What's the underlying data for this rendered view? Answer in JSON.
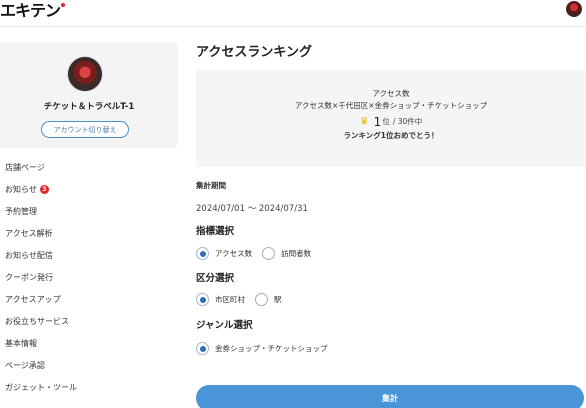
{
  "header": {
    "logo_text": "エキテン"
  },
  "sidebar": {
    "profile_name": "チケット＆トラベルT-1",
    "switch_account_label": "アカウント切り替え",
    "menu": [
      {
        "label": "店舗ページ"
      },
      {
        "label": "お知らせ",
        "badge": "3"
      },
      {
        "label": "予約管理"
      },
      {
        "label": "アクセス解析"
      },
      {
        "label": "お知らせ配信"
      },
      {
        "label": "クーポン発行"
      },
      {
        "label": "アクセスアップ"
      },
      {
        "label": "お役立ちサービス"
      },
      {
        "label": "基本情報"
      },
      {
        "label": "ページ承認"
      },
      {
        "label": "ガジェット・ツール"
      }
    ]
  },
  "main": {
    "title": "アクセスランキング",
    "ranking": {
      "metric": "アクセス数",
      "condition": "アクセス数×千代田区×金券ショップ・チケットショップ",
      "rank": "1",
      "rank_suffix": "位",
      "total": "/ 30件中",
      "message": "ランキング1位おめでとう！"
    },
    "period_label": "集計期間",
    "period_value": "2024/07/01 ～ 2024/07/31",
    "indicator": {
      "heading": "指標選択",
      "options": [
        {
          "label": "アクセス数",
          "selected": true
        },
        {
          "label": "訪問者数",
          "selected": false
        }
      ]
    },
    "division": {
      "heading": "区分選択",
      "options": [
        {
          "label": "市区町村",
          "selected": true
        },
        {
          "label": "駅",
          "selected": false
        }
      ]
    },
    "genre": {
      "heading": "ジャンル選択",
      "options": [
        {
          "label": "金券ショップ・チケットショップ",
          "selected": true
        }
      ]
    },
    "submit_label": "集計"
  },
  "colors": {
    "accent": "#4a95d8",
    "badge": "#e3262e",
    "crown": "#e8b800"
  }
}
